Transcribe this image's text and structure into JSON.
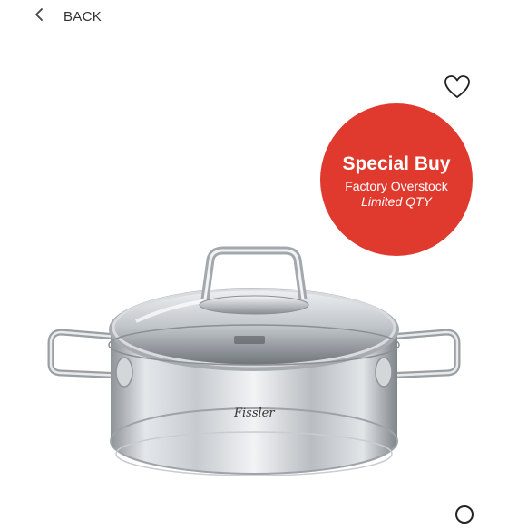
{
  "nav": {
    "back_label": "BACK",
    "back_icon": "chevron-left-icon"
  },
  "favorite": {
    "icon": "heart-outline-icon"
  },
  "badge": {
    "title": "Special Buy",
    "subtitle": "Factory Overstock",
    "note": "Limited QTY",
    "color": "#e03a2f"
  },
  "product": {
    "brand_mark": "Fissler"
  },
  "bottom": {
    "icon": "circle-outline-icon"
  }
}
